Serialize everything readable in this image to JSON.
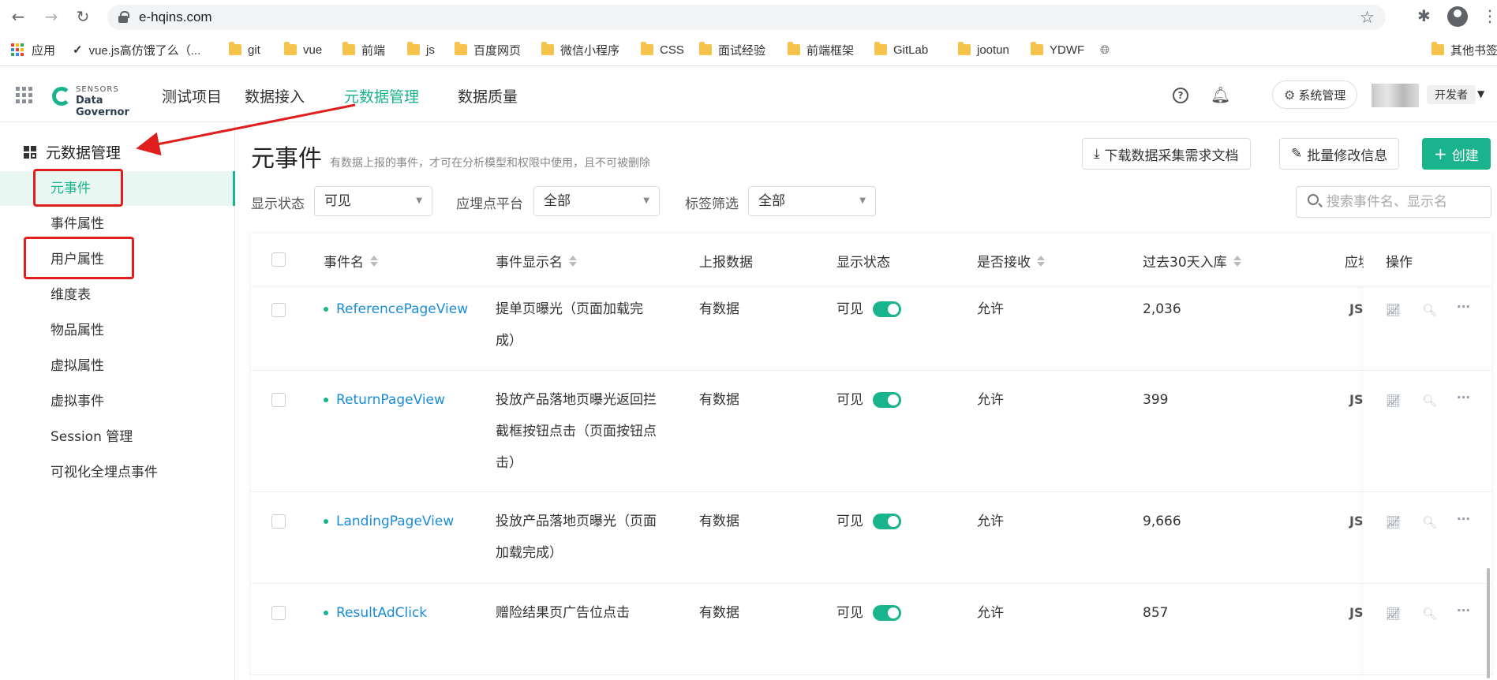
{
  "browser": {
    "url": "e-hqins.com",
    "bookmarks": [
      {
        "label": "应用",
        "icon": "apps-icon"
      },
      {
        "label": "vue.js高仿饿了么（...",
        "icon": "vue-icon"
      },
      {
        "label": "git",
        "icon": "folder-icon"
      },
      {
        "label": "vue",
        "icon": "folder-icon"
      },
      {
        "label": "前端",
        "icon": "folder-icon"
      },
      {
        "label": "js",
        "icon": "folder-icon"
      },
      {
        "label": "百度网页",
        "icon": "folder-icon"
      },
      {
        "label": "微信小程序",
        "icon": "folder-icon"
      },
      {
        "label": "CSS",
        "icon": "folder-icon"
      },
      {
        "label": "面试经验",
        "icon": "folder-icon"
      },
      {
        "label": "前端框架",
        "icon": "folder-icon"
      },
      {
        "label": "GitLab",
        "icon": "folder-icon"
      },
      {
        "label": "jootun",
        "icon": "folder-icon"
      },
      {
        "label": "YDWF",
        "icon": "folder-icon"
      },
      {
        "label": "",
        "icon": "globe-icon"
      }
    ],
    "other_bookmarks": "其他书签"
  },
  "header": {
    "logo_line1": "SENSORS",
    "logo_line2": "Data Governor",
    "project": "测试项目",
    "nav": [
      "数据接入",
      "元数据管理",
      "数据质量"
    ],
    "active_nav": "元数据管理",
    "sys_button": "系统管理",
    "role": "开发者"
  },
  "sidebar": {
    "title": "元数据管理",
    "items": [
      "元事件",
      "事件属性",
      "用户属性",
      "维度表",
      "物品属性",
      "虚拟属性",
      "虚拟事件",
      "Session 管理",
      "可视化全埋点事件"
    ],
    "active": "元事件"
  },
  "page": {
    "title": "元事件",
    "subtitle": "有数据上报的事件，才可在分析模型和权限中使用，且不可被删除",
    "download_button": "下载数据采集需求文档",
    "batch_button": "批量修改信息",
    "create_button": "创建"
  },
  "filters": {
    "status_label": "显示状态",
    "status_value": "可见",
    "platform_label": "应埋点平台",
    "platform_value": "全部",
    "tag_label": "标签筛选",
    "tag_value": "全部",
    "search_placeholder": "搜索事件名、显示名"
  },
  "table": {
    "columns": [
      "事件名",
      "事件显示名",
      "上报数据",
      "显示状态",
      "是否接收",
      "过去30天入库",
      "应埋",
      "操作"
    ],
    "rows": [
      {
        "name": "ReferencePageView",
        "display_lines": [
          "提单页曝光（页面加载完",
          "成）"
        ],
        "has_data": "有数据",
        "status": "可见",
        "visible": true,
        "accept": "允许",
        "count_30d": "2,036",
        "platform": "JS"
      },
      {
        "name": "ReturnPageView",
        "display_lines": [
          "投放产品落地页曝光返回拦",
          "截框按钮点击（页面按钮点",
          "击）"
        ],
        "has_data": "有数据",
        "status": "可见",
        "visible": true,
        "accept": "允许",
        "count_30d": "399",
        "platform": "JS"
      },
      {
        "name": "LandingPageView",
        "display_lines": [
          "投放产品落地页曝光（页面",
          "加载完成）"
        ],
        "has_data": "有数据",
        "status": "可见",
        "visible": true,
        "accept": "允许",
        "count_30d": "9,666",
        "platform": "JS"
      },
      {
        "name": "ResultAdClick",
        "display_lines": [
          "赠险结果页广告位点击"
        ],
        "has_data": "有数据",
        "status": "可见",
        "visible": true,
        "accept": "允许",
        "count_30d": "857",
        "platform": "JS"
      }
    ]
  },
  "colors": {
    "accent": "#19b38d",
    "link": "#1a8cd8",
    "annotation": "#e01e1e"
  }
}
